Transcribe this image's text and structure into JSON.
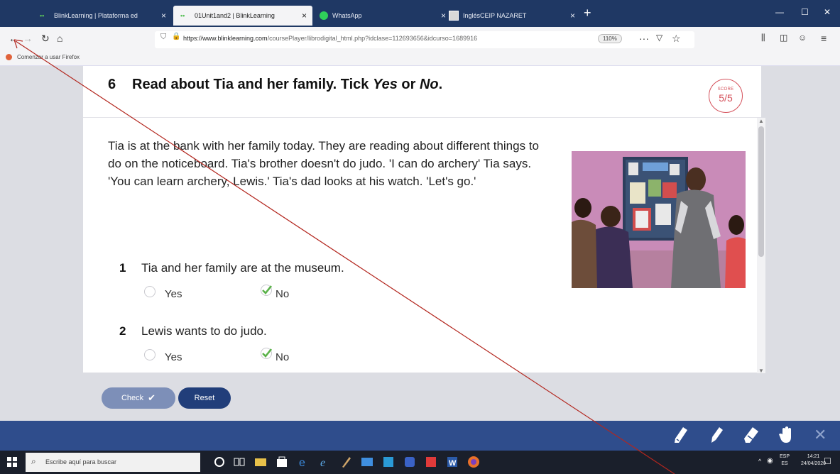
{
  "browser": {
    "tabs": [
      {
        "label": "BlinkLearning | Plataforma ed",
        "active": false
      },
      {
        "label": "01Unit1and2 | BlinkLearning",
        "active": true
      },
      {
        "label": "WhatsApp",
        "active": false
      },
      {
        "label": "InglésCEIP NAZARET",
        "active": false
      }
    ],
    "url_domain": "https://www.blinklearning.com",
    "url_path": "/coursePlayer/librodigital_html.php?idclase=112693656&idcurso=1689916",
    "zoom": "110%",
    "bookmark": "Comenzar a usar Firefox"
  },
  "exercise": {
    "number": "6",
    "title": "Read about Tia and her family. Tick Yes or No.",
    "score_label": "SCORE",
    "score_value": "5/5",
    "passage": "Tia is at the bank with her family today.  They are reading about different things to do on the noticeboard.  Tia's brother doesn't do judo. 'I can do archery' Tia says. 'You can learn archery, Lewis.'  Tia's dad looks at his watch.  'Let's go.'",
    "questions": [
      {
        "number": "1",
        "text": "Tia and her family are at the museum.",
        "yes": "Yes",
        "no": "No",
        "selected": "No"
      },
      {
        "number": "2",
        "text": "Lewis wants to do judo.",
        "yes": "Yes",
        "no": "No",
        "selected": "No"
      }
    ],
    "check_label": "Check",
    "reset_label": "Reset"
  },
  "taskbar": {
    "search_placeholder": "Escribe aquí para buscar",
    "lang_line1": "ESP",
    "lang_line2": "ES",
    "time": "14:21",
    "date": "24/04/2020"
  },
  "icons": [
    "back-icon",
    "forward-icon",
    "reload-icon",
    "home-icon",
    "shield-icon",
    "lock-icon",
    "pocket-icon",
    "star-icon",
    "library-icon",
    "sidebar-icon",
    "account-icon",
    "menu-icon",
    "pencil-icon",
    "marker-icon",
    "eraser-icon",
    "hand-icon",
    "close-icon",
    "windows-icon",
    "search-icon"
  ],
  "colors": {
    "accent": "#213e7a",
    "score": "#d4505a",
    "check": "#5bb24a"
  }
}
